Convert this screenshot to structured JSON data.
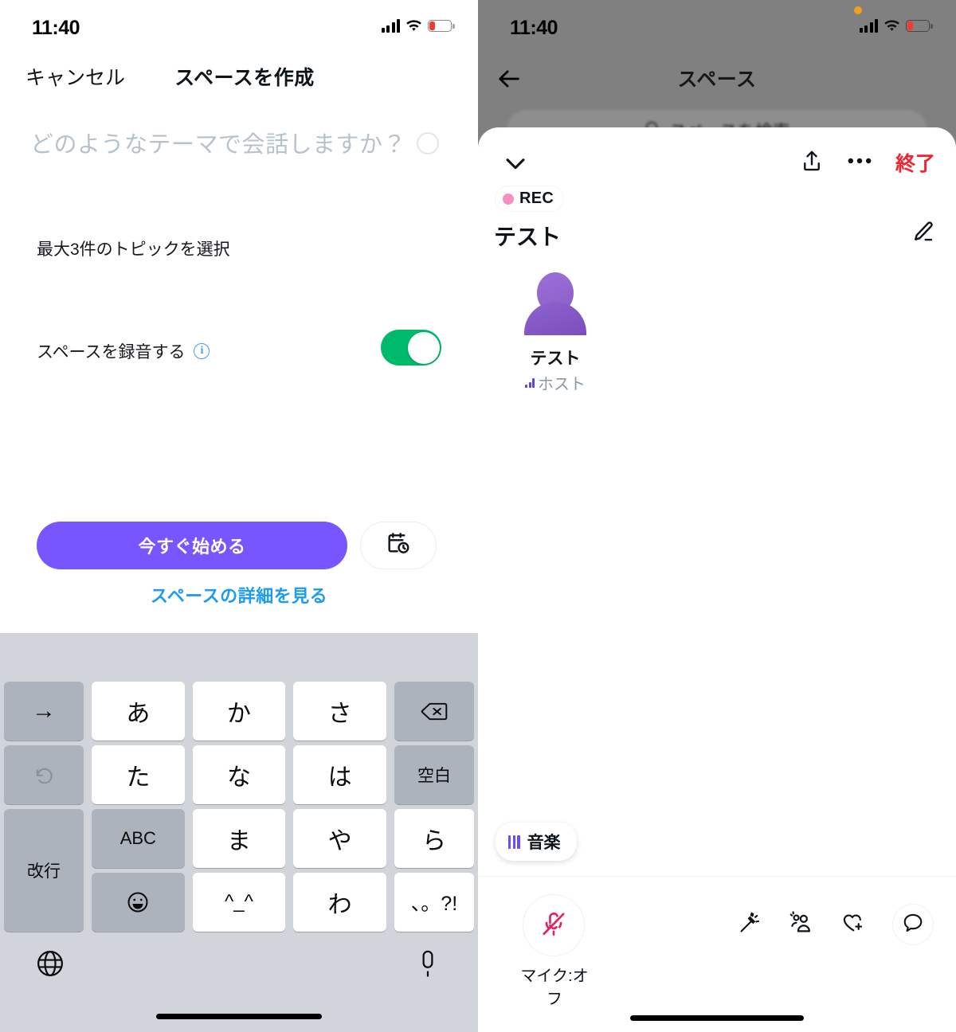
{
  "left": {
    "status": {
      "time": "11:40",
      "signal_icon": "cellular-bars-icon",
      "wifi_icon": "wifi-icon",
      "battery_icon": "battery-low-icon"
    },
    "nav": {
      "cancel_label": "キャンセル",
      "title": "スペースを作成"
    },
    "compose": {
      "placeholder": "どのようなテーマで会話しますか？",
      "value": "",
      "counter_icon": "character-counter-ring-icon"
    },
    "topic_label": "最大3件のトピックを選択",
    "record": {
      "label": "スペースを録音する",
      "info_icon": "info-circle-icon",
      "toggle_on": true,
      "toggle_color": "#00ba6c"
    },
    "actions": {
      "start_label": "今すぐ始める",
      "start_color": "#7856ff",
      "schedule_icon": "calendar-clock-icon",
      "details_label": "スペースの詳細を見る",
      "details_color": "#1d9bf0"
    },
    "keyboard": {
      "keys": [
        [
          "→",
          "あ",
          "か",
          "さ",
          "⌫"
        ],
        [
          "↺",
          "た",
          "な",
          "は",
          "空白"
        ],
        [
          "ABC",
          "ま",
          "や",
          "ら",
          "改行"
        ],
        [
          "☺",
          "^_^",
          "わ",
          "、。?!",
          ""
        ]
      ],
      "globe_icon": "globe-icon",
      "dictation_icon": "microphone-icon",
      "home_indicator": "home-indicator"
    }
  },
  "right": {
    "status": {
      "time": "11:40",
      "recording_dot": "orange-recording-dot",
      "signal_icon": "cellular-bars-icon",
      "wifi_icon": "wifi-icon",
      "battery_icon": "battery-low-icon"
    },
    "nav": {
      "back_icon": "arrow-left-icon",
      "title": "スペース"
    },
    "search": {
      "placeholder": "スペースを検索",
      "icon": "search-icon"
    },
    "sheet": {
      "collapse_icon": "chevron-down-icon",
      "share_icon": "share-upload-icon",
      "more_icon": "more-horizontal-icon",
      "end_label": "終了",
      "end_color": "#f4212e",
      "rec_badge": "REC",
      "rec_dot_color": "#f491c0",
      "space_title": "テスト",
      "edit_icon": "pencil-edit-icon",
      "speaker": {
        "name": "テスト",
        "role": "ホスト",
        "avatar_icon": "person-avatar-icon",
        "level_icon": "audio-level-icon"
      },
      "music_chip": {
        "label": "音楽",
        "icon": "music-bars-icon"
      },
      "toolbar": {
        "mic_icon": "microphone-muted-icon",
        "mic_label": "マイク:オフ",
        "mic_color": "#e0245e",
        "magic_icon": "magic-wand-icon",
        "people_icon": "request-to-speak-icon",
        "react_icon": "heart-plus-icon",
        "chat_icon": "chat-bubble-icon"
      },
      "home_indicator": "home-indicator"
    }
  }
}
